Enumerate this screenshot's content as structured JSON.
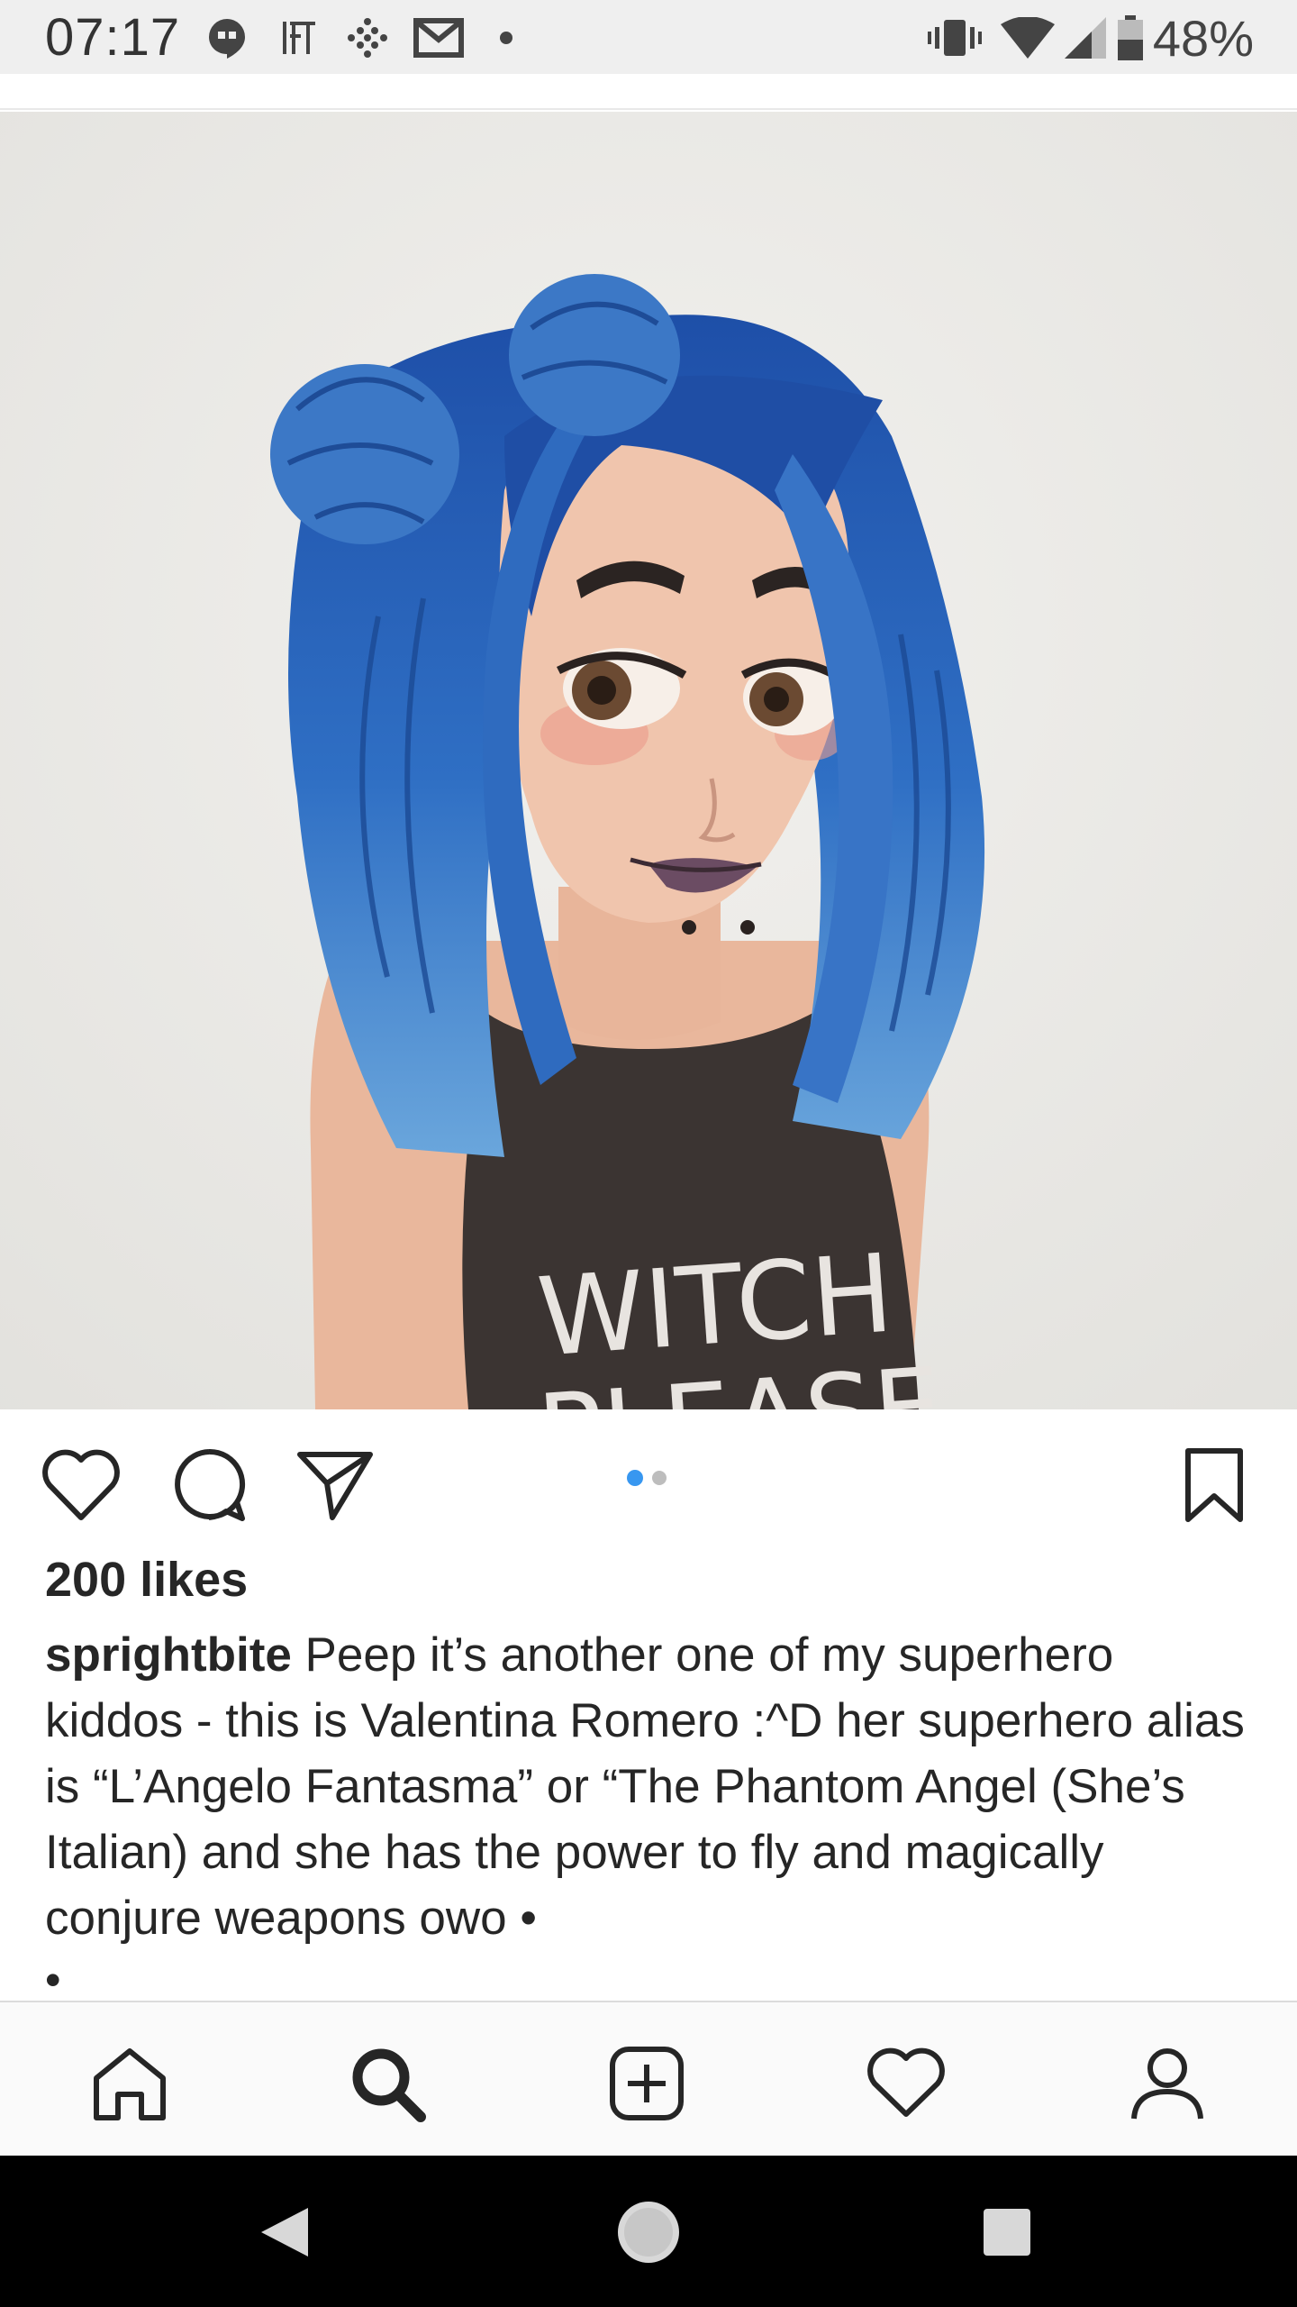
{
  "status_bar": {
    "time": "07:17",
    "notification_icons": [
      "hangouts-icon",
      "ifttt-icon",
      "slack-icon",
      "gmail-icon",
      "more-dot-icon"
    ],
    "system_icons": [
      "vibrate-icon",
      "wifi-icon",
      "signal-icon",
      "battery-icon"
    ],
    "battery_percent": "48%"
  },
  "post": {
    "image": {
      "subject": "watercolor-girl-blue-hair-illustration",
      "shirt_text_line1": "WITCH",
      "shirt_text_line2": "PLEASE"
    },
    "carousel": {
      "total": 2,
      "active_index": 0,
      "active_color": "#3897f0"
    },
    "likes_text": "200 likes",
    "caption": {
      "username": "sprightbite",
      "text": " Peep it’s another one of my superhero kiddos - this is Valentina Romero :^D her superhero alias is “L’Angelo Fantasma” or “The Phantom Angel (She’s Italian) and she has the power to fly and magically conjure weapons owo •",
      "trailing_bullet": "•"
    }
  },
  "actions": {
    "like": "heart-icon",
    "comment": "comment-icon",
    "share": "paper-plane-icon",
    "save": "bookmark-icon"
  },
  "bottom_nav": [
    "home-icon",
    "search-icon",
    "new-post-icon",
    "activity-heart-icon",
    "profile-icon"
  ],
  "system_nav": [
    "back-icon",
    "home-circle-icon",
    "recents-icon"
  ],
  "colors": {
    "accent_blue": "#3897f0",
    "text": "#262626",
    "status_bar_bg": "#efefef"
  }
}
